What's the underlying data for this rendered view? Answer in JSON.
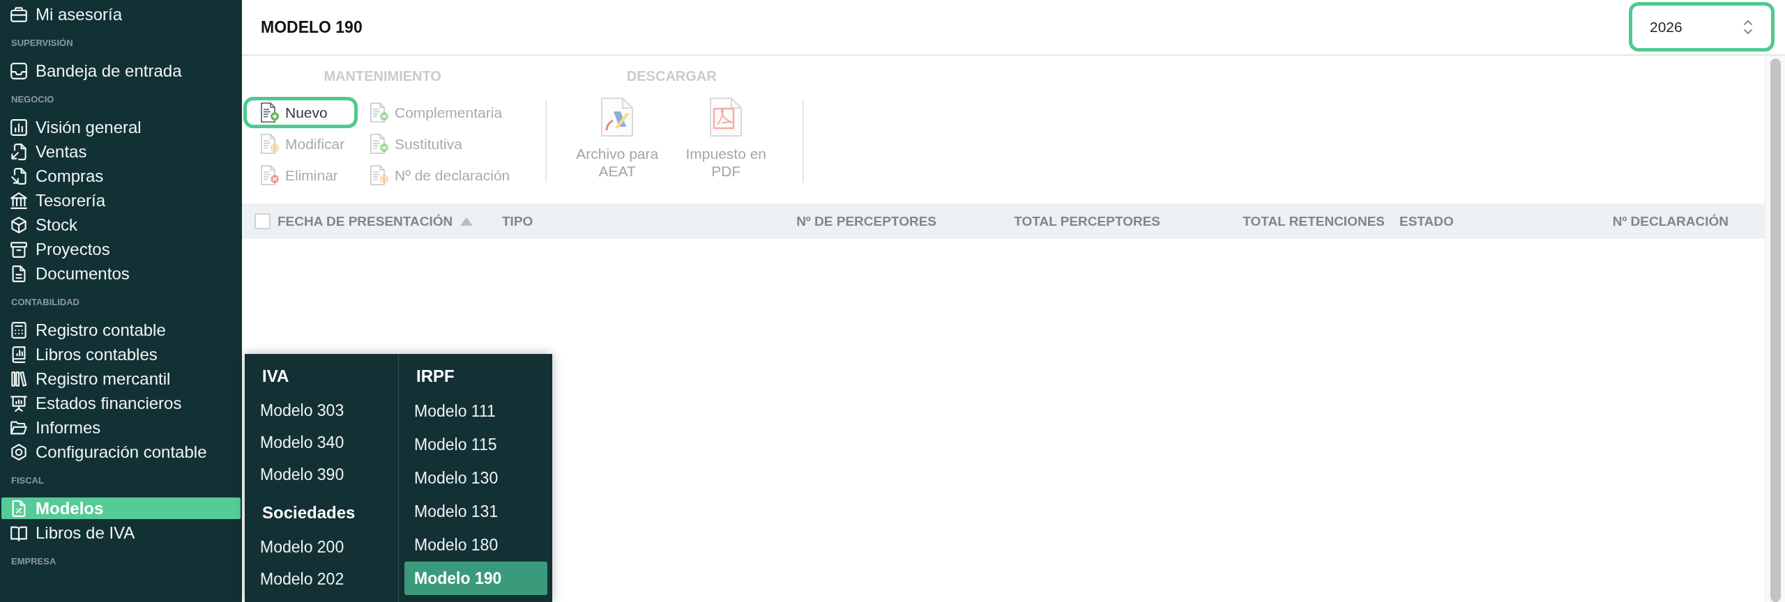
{
  "sidebar": {
    "sections": [
      {
        "items": [
          {
            "label": "Mi asesoría",
            "selected": false
          }
        ]
      },
      {
        "title": "SUPERVISIÓN",
        "items": [
          {
            "label": "Bandeja de entrada",
            "selected": false
          }
        ]
      },
      {
        "title": "NEGOCIO",
        "items": [
          {
            "label": "Visión general",
            "selected": false
          },
          {
            "label": "Ventas",
            "selected": false
          },
          {
            "label": "Compras",
            "selected": false
          },
          {
            "label": "Tesorería",
            "selected": false
          },
          {
            "label": "Stock",
            "selected": false
          },
          {
            "label": "Proyectos",
            "selected": false
          },
          {
            "label": "Documentos",
            "selected": false
          }
        ]
      },
      {
        "title": "CONTABILIDAD",
        "items": [
          {
            "label": "Registro contable",
            "selected": false
          },
          {
            "label": "Libros contables",
            "selected": false
          },
          {
            "label": "Registro mercantil",
            "selected": false
          },
          {
            "label": "Estados financieros",
            "selected": false
          },
          {
            "label": "Informes",
            "selected": false
          },
          {
            "label": "Configuración contable",
            "selected": false
          }
        ]
      },
      {
        "title": "FISCAL",
        "items": [
          {
            "label": "Modelos",
            "selected": true
          },
          {
            "label": "Libros de IVA",
            "selected": false
          }
        ]
      },
      {
        "title": "EMPRESA"
      }
    ]
  },
  "header": {
    "title": "MODELO 190",
    "year_field": {
      "value": "2026",
      "highlighted": true
    }
  },
  "toolbar": {
    "groups": [
      {
        "kind": "grid",
        "label": "MANTENIMIENTO",
        "buttons": [
          {
            "label": "Nuevo",
            "disabled": false,
            "highlighted": true
          },
          {
            "label": "Modificar",
            "disabled": true,
            "highlighted": false
          },
          {
            "label": "Eliminar",
            "disabled": true,
            "highlighted": false
          },
          {
            "label": "Complementaria",
            "disabled": true,
            "highlighted": false
          },
          {
            "label": "Sustitutiva",
            "disabled": true,
            "highlighted": false
          },
          {
            "label": "Nº de declaración",
            "disabled": true,
            "highlighted": false
          }
        ]
      },
      {
        "kind": "large",
        "label": "DESCARGAR",
        "buttons": [
          {
            "label": "Archivo para AEAT",
            "disabled": true,
            "highlighted": false
          },
          {
            "label": "Impuesto en PDF",
            "disabled": true,
            "highlighted": false
          }
        ]
      }
    ]
  },
  "table": {
    "select_all": {
      "checked": false
    },
    "columns": [
      {
        "label": "FECHA DE PRESENTACIÓN",
        "sorted": true
      },
      {
        "label": "TIPO",
        "sorted": false
      },
      {
        "label": "Nº DE PERCEPTORES",
        "sorted": false
      },
      {
        "label": "TOTAL PERCEPTORES",
        "sorted": false
      },
      {
        "label": "TOTAL RETENCIONES",
        "sorted": false
      },
      {
        "label": "ESTADO",
        "sorted": false
      },
      {
        "label": "Nº DECLARACIÓN",
        "sorted": false
      }
    ]
  },
  "menu": {
    "columns": [
      {
        "groups": [
          {
            "title": "IVA",
            "items": [
              {
                "label": "Modelo 303",
                "selected": false
              },
              {
                "label": "Modelo 340",
                "selected": false
              },
              {
                "label": "Modelo 390",
                "selected": false
              }
            ]
          },
          {
            "title": "Sociedades",
            "items": [
              {
                "label": "Modelo 200",
                "selected": false
              },
              {
                "label": "Modelo 202",
                "selected": false
              }
            ]
          }
        ]
      },
      {
        "groups": [
          {
            "title": "IRPF",
            "items": [
              {
                "label": "Modelo 111",
                "selected": false
              },
              {
                "label": "Modelo 115",
                "selected": false
              },
              {
                "label": "Modelo 130",
                "selected": false
              },
              {
                "label": "Modelo 131",
                "selected": false
              },
              {
                "label": "Modelo 180",
                "selected": false
              },
              {
                "label": "Modelo 190",
                "selected": true
              }
            ]
          }
        ]
      }
    ]
  }
}
